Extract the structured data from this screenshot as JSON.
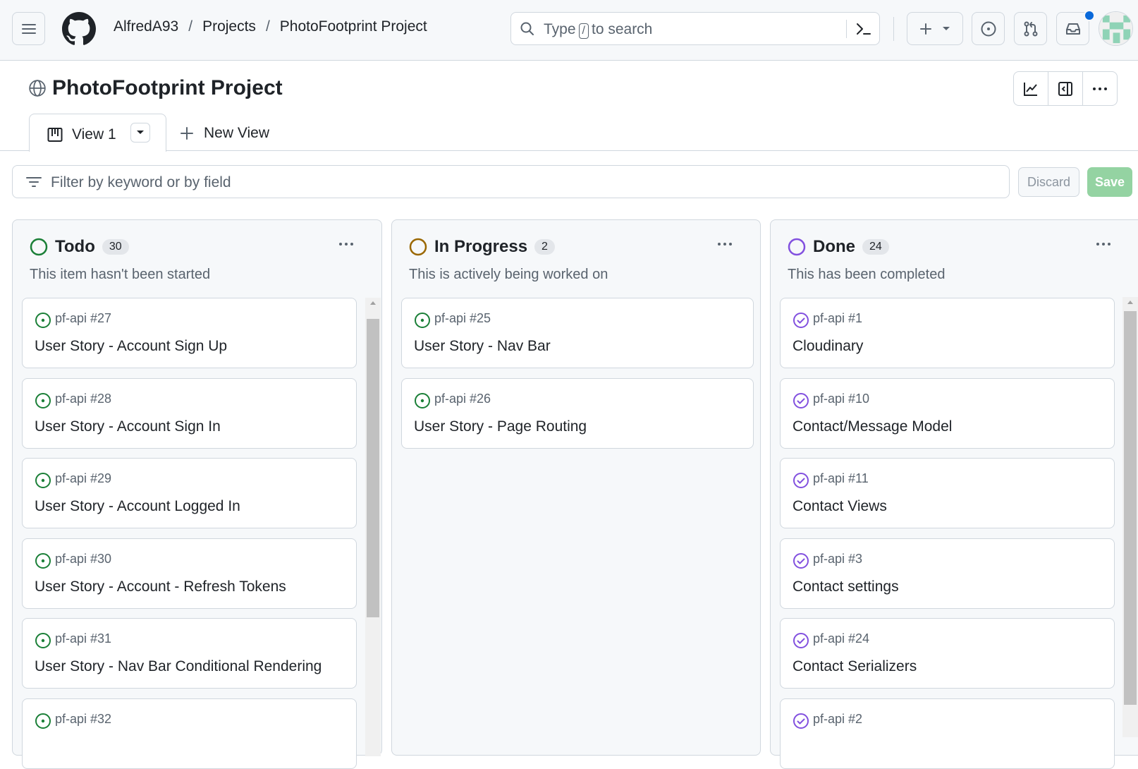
{
  "header": {
    "breadcrumbs": [
      {
        "label": "AlfredA93"
      },
      {
        "label": "Projects"
      },
      {
        "label": "PhotoFootprint Project"
      }
    ],
    "separator": "/",
    "search": {
      "prefix": "Type",
      "key": "/",
      "suffix": "to search"
    }
  },
  "project": {
    "title": "PhotoFootprint Project"
  },
  "tabs": {
    "active_label": "View 1",
    "new_view_label": "New View"
  },
  "filter": {
    "placeholder": "Filter by keyword or by field",
    "discard_label": "Discard",
    "save_label": "Save"
  },
  "colors": {
    "todo": "#1a7f37",
    "in_progress": "#9a6700",
    "done": "#8250df",
    "save": "#94d3a2",
    "notification": "#0969da"
  },
  "columns": [
    {
      "name": "Todo",
      "count": "30",
      "description": "This item hasn't been started",
      "cards": [
        {
          "meta": "pf-api #27",
          "title": "User Story - Account Sign Up"
        },
        {
          "meta": "pf-api #28",
          "title": "User Story - Account Sign In"
        },
        {
          "meta": "pf-api #29",
          "title": "User Story - Account Logged In"
        },
        {
          "meta": "pf-api #30",
          "title": "User Story - Account - Refresh Tokens"
        },
        {
          "meta": "pf-api #31",
          "title": "User Story - Nav Bar Conditional Rendering"
        },
        {
          "meta": "pf-api #32",
          "title": ""
        }
      ]
    },
    {
      "name": "In Progress",
      "count": "2",
      "description": "This is actively being worked on",
      "cards": [
        {
          "meta": "pf-api #25",
          "title": "User Story - Nav Bar"
        },
        {
          "meta": "pf-api #26",
          "title": "User Story - Page Routing"
        }
      ]
    },
    {
      "name": "Done",
      "count": "24",
      "description": "This has been completed",
      "cards": [
        {
          "meta": "pf-api #1",
          "title": "Cloudinary"
        },
        {
          "meta": "pf-api #10",
          "title": "Contact/Message Model"
        },
        {
          "meta": "pf-api #11",
          "title": "Contact Views"
        },
        {
          "meta": "pf-api #3",
          "title": "Contact settings"
        },
        {
          "meta": "pf-api #24",
          "title": "Contact Serializers"
        },
        {
          "meta": "pf-api #2",
          "title": ""
        }
      ]
    }
  ]
}
